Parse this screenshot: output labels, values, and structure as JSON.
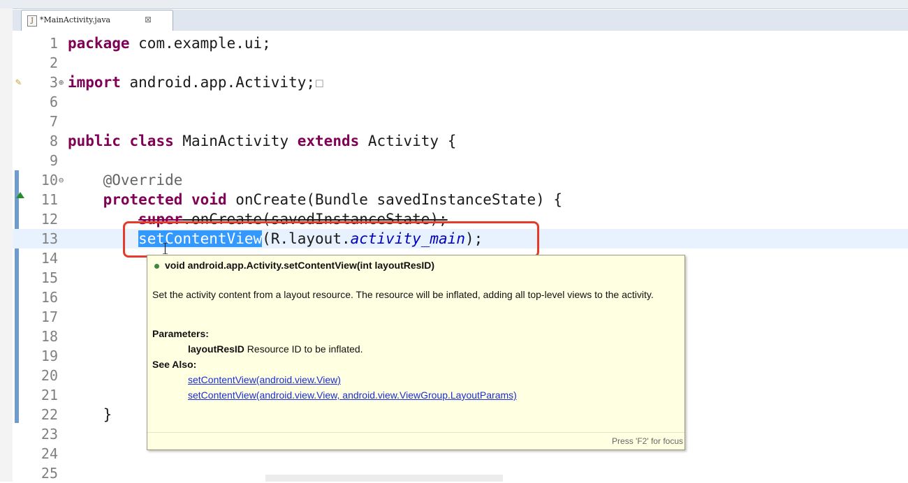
{
  "editor_tab": {
    "label": "*MainActivity.java",
    "icon": "java-file-icon",
    "close_symbol": "⊠"
  },
  "code_lines": [
    {
      "num": "1",
      "parts": [
        {
          "t": "package",
          "c": "kw"
        },
        {
          "t": " com.example.ui;",
          "c": ""
        }
      ]
    },
    {
      "num": "2",
      "parts": []
    },
    {
      "num": "3",
      "parts": [
        {
          "t": "import",
          "c": "kw"
        },
        {
          "t": " android.app.Activity;",
          "c": ""
        }
      ],
      "fold": "⊕",
      "collapsed": "☐"
    },
    {
      "num": "6",
      "parts": []
    },
    {
      "num": "7",
      "parts": []
    },
    {
      "num": "8",
      "parts": [
        {
          "t": "public",
          "c": "kw"
        },
        {
          "t": " ",
          "c": ""
        },
        {
          "t": "class",
          "c": "kw"
        },
        {
          "t": " MainActivity ",
          "c": ""
        },
        {
          "t": "extends",
          "c": "kw"
        },
        {
          "t": " Activity {",
          "c": ""
        }
      ]
    },
    {
      "num": "9",
      "parts": []
    },
    {
      "num": "10",
      "parts": [
        {
          "t": "    @Override",
          "c": "ann"
        }
      ],
      "fold": "⊖"
    },
    {
      "num": "11",
      "parts": [
        {
          "t": "    ",
          "c": ""
        },
        {
          "t": "protected",
          "c": "kw"
        },
        {
          "t": " ",
          "c": ""
        },
        {
          "t": "void",
          "c": "kw"
        },
        {
          "t": " onCreate(Bundle savedInstanceState) {",
          "c": ""
        }
      ]
    },
    {
      "num": "12",
      "parts": [
        {
          "t": "        ",
          "c": ""
        },
        {
          "t": "super",
          "c": "kw strike"
        },
        {
          "t": ".onCreate(savedInstanceState);",
          "c": "strike"
        }
      ]
    },
    {
      "num": "13",
      "parts": [
        {
          "t": "        ",
          "c": ""
        },
        {
          "t": "setContentView",
          "c": "hl"
        },
        {
          "t": "(R.layout.",
          "c": ""
        },
        {
          "t": "activity_main",
          "c": "it"
        },
        {
          "t": ");",
          "c": ""
        }
      ],
      "current": true
    },
    {
      "num": "14",
      "parts": []
    },
    {
      "num": "15",
      "parts": []
    },
    {
      "num": "16",
      "parts": []
    },
    {
      "num": "17",
      "parts": []
    },
    {
      "num": "18",
      "parts": []
    },
    {
      "num": "19",
      "parts": []
    },
    {
      "num": "20",
      "parts": []
    },
    {
      "num": "21",
      "parts": []
    },
    {
      "num": "22",
      "parts": [
        {
          "t": "    }",
          "c": ""
        }
      ]
    },
    {
      "num": "23",
      "parts": []
    },
    {
      "num": "24",
      "parts": []
    },
    {
      "num": "25",
      "parts": []
    }
  ],
  "tooltip": {
    "signature": "void android.app.Activity.setContentView(int layoutResID)",
    "description": "Set the activity content from a layout resource. The resource will be inflated, adding all top-level views to the activity.",
    "parameters_heading": "Parameters:",
    "param_name": "layoutResID",
    "param_desc": " Resource ID to be inflated.",
    "see_also_heading": "See Also:",
    "links": [
      "setContentView(android.view.View)",
      "setContentView(android.view.View, android.view.ViewGroup.LayoutParams)"
    ],
    "focus_hint": "Press 'F2' for focus"
  }
}
